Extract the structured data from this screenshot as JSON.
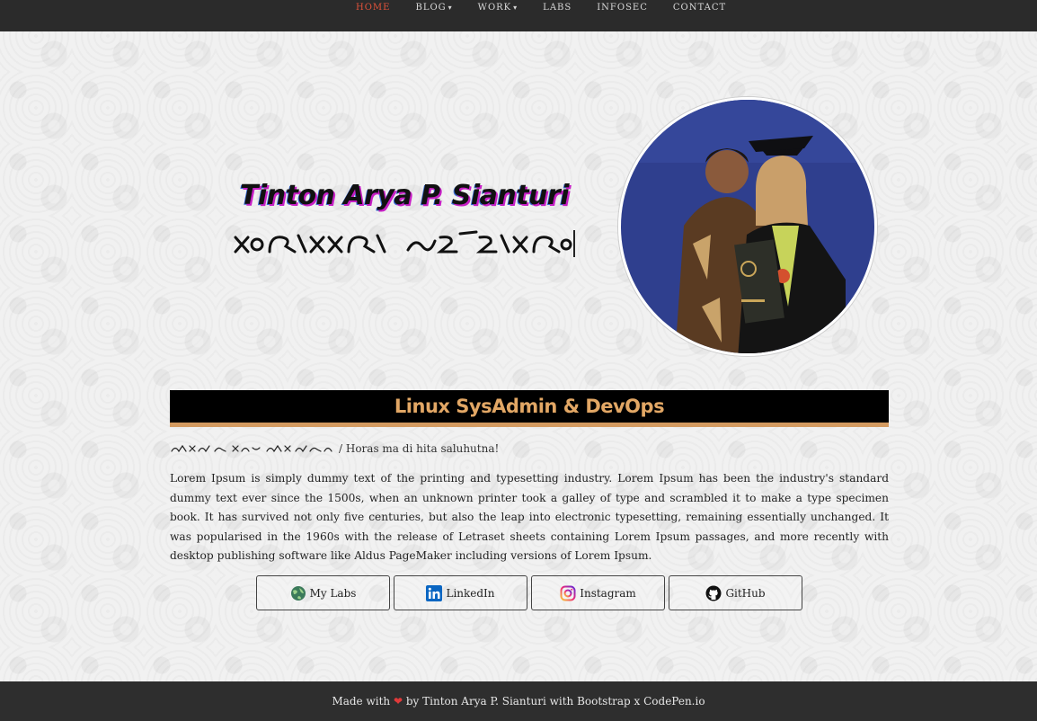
{
  "nav": {
    "items": [
      {
        "label": "HOME",
        "active": true,
        "dropdown": false
      },
      {
        "label": "BLOG",
        "active": false,
        "dropdown": true
      },
      {
        "label": "WORK",
        "active": false,
        "dropdown": true
      },
      {
        "label": "LABS",
        "active": false,
        "dropdown": false
      },
      {
        "label": "INFOSEC",
        "active": false,
        "dropdown": false
      },
      {
        "label": "CONTACT",
        "active": false,
        "dropdown": false
      }
    ],
    "caret": "▾",
    "active_color": "#e0523a"
  },
  "hero": {
    "name": "Tinton Arya P. Sianturi",
    "script_name_icon": "batak-script-name",
    "photo_icon": "graduation-photo"
  },
  "section": {
    "title": "Linux SysAdmin & DevOps",
    "greeting_script_icon": "batak-script-greeting",
    "greeting_text": "/ Horas ma di hita saluhutna!",
    "body": "Lorem Ipsum is simply dummy text of the printing and typesetting industry. Lorem Ipsum has been the industry's standard dummy text ever since the 1500s, when an unknown printer took a galley of type and scrambled it to make a type specimen book. It has survived not only five centuries, but also the leap into electronic typesetting, remaining essentially unchanged. It was popularised in the 1960s with the release of Letraset sheets containing Lorem Ipsum passages, and more recently with desktop publishing software like Aldus PageMaker including versions of Lorem Ipsum.",
    "accent_color": "#d39a60"
  },
  "buttons": [
    {
      "label": "My Labs",
      "icon": "globe-icon"
    },
    {
      "label": "LinkedIn",
      "icon": "linkedin-icon"
    },
    {
      "label": "Instagram",
      "icon": "instagram-icon"
    },
    {
      "label": "GitHub",
      "icon": "github-icon"
    }
  ],
  "footer": {
    "prefix": "Made with",
    "heart": "❤",
    "suffix": "by Tinton Arya P. Sianturi with Bootstrap x CodePen.io"
  }
}
